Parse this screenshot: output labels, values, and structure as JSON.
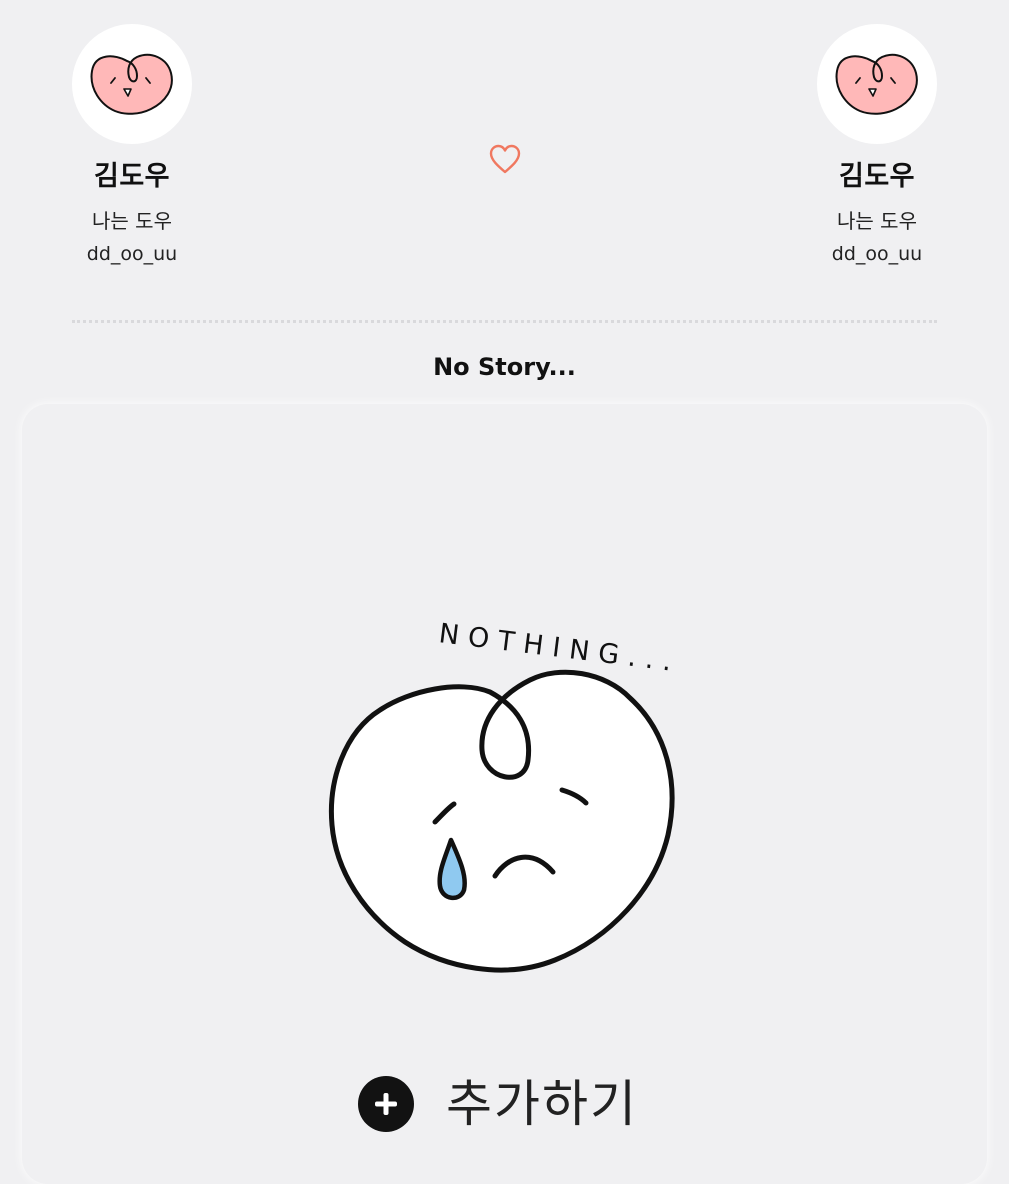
{
  "profiles": [
    {
      "name": "김도우",
      "bio": "나는 도우",
      "id": "dd_oo_uu",
      "avatar_icon": "pink-heart-face-icon"
    },
    {
      "name": "김도우",
      "bio": "나는 도우",
      "id": "dd_oo_uu",
      "avatar_icon": "pink-heart-face-icon"
    }
  ],
  "center_icon": "heart-outline-icon",
  "story": {
    "title": "No Story...",
    "illustration_text": "NOTHING...",
    "illustration_icon": "crying-heart-face-icon"
  },
  "add_button": {
    "label": "추가하기",
    "icon": "plus-circle-icon"
  },
  "colors": {
    "background": "#f0f0f2",
    "heart_outline": "#f07860",
    "avatar_face": "#ffb8b8",
    "tear": "#8fc9f0"
  }
}
